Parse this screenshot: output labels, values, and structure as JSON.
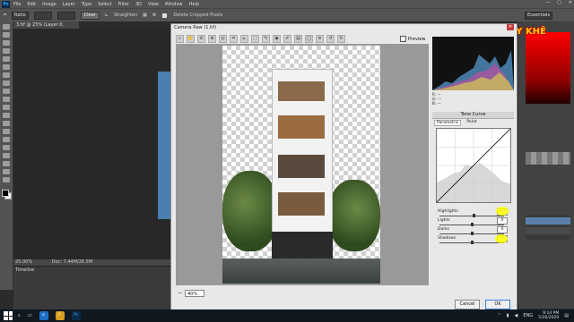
{
  "menubar": {
    "logo": "Ps",
    "items": [
      "File",
      "Edit",
      "Image",
      "Layer",
      "Type",
      "Select",
      "Filter",
      "3D",
      "View",
      "Window",
      "Help"
    ],
    "win_controls": [
      "—",
      "▢",
      "✕"
    ]
  },
  "options": {
    "style_value": "Ratio",
    "clear_label": "Clear",
    "straighten_label": "Straighten",
    "delete_cropped_label": "Delete Cropped Pixels",
    "essentials_label": "Essentials"
  },
  "document": {
    "tab_title": "3.tif @ 25% (Layer 0, RGB/8#) *",
    "status": "25.00%",
    "doc_size": "Doc: 7.44M/26.5M",
    "timeline_label": "Timeline"
  },
  "watermark": "THỦY KHÊ",
  "dialog": {
    "title": "Camera Raw (1.tif)",
    "close": "✕",
    "preview_label": "Preview",
    "zoom_value": "40%",
    "zoom_minus": "−",
    "readout": [
      "R: ---",
      "G: ---",
      "B: ---"
    ],
    "tone_curve_title": "Tone Curve",
    "tabs": [
      "Parametric",
      "Point"
    ],
    "sliders": [
      {
        "label": "Highlights",
        "value": "+3",
        "pos": 0.53
      },
      {
        "label": "Lights",
        "value": "0",
        "pos": 0.5
      },
      {
        "label": "Darks",
        "value": "0",
        "pos": 0.5
      },
      {
        "label": "Shadows",
        "value": "0",
        "pos": 0.5
      }
    ],
    "cancel_label": "Cancel",
    "ok_label": "OK"
  },
  "taskbar": {
    "search_icon": "search-icon",
    "apps": [
      "e",
      "F",
      "Ps"
    ],
    "lang": "ENG",
    "time": "9:14 PM",
    "date": "5/26/2020"
  },
  "colors": {
    "ps_blue": "#31a8ff",
    "highlight": "#ffff00",
    "watermark": "#ffcc00"
  }
}
